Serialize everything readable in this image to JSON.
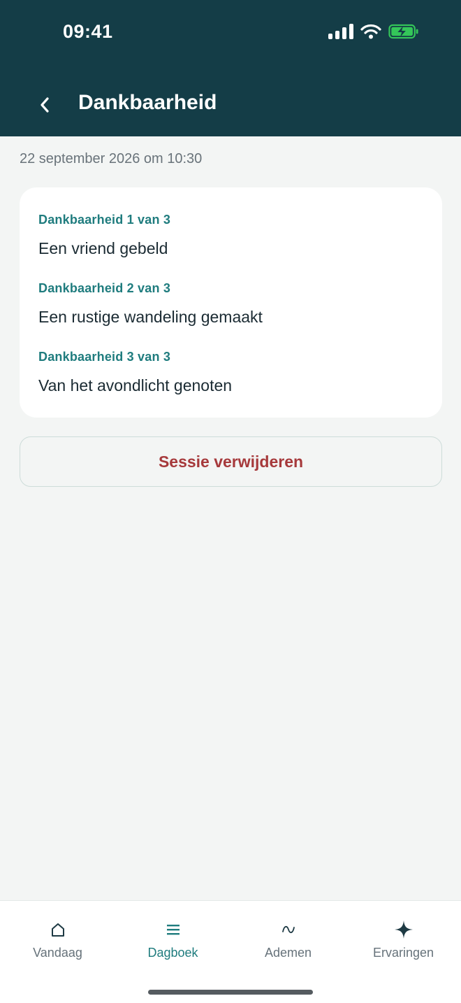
{
  "status_bar": {
    "time": "09:41"
  },
  "header": {
    "title": "Dankbaarheid"
  },
  "timestamp": "22 september 2026 om 10:30",
  "entries": [
    {
      "label": "Dankbaarheid 1 van 3",
      "text": "Een vriend gebeld"
    },
    {
      "label": "Dankbaarheid 2 van 3",
      "text": "Een rustige wandeling gemaakt"
    },
    {
      "label": "Dankbaarheid 3 van 3",
      "text": "Van het avondlicht genoten"
    }
  ],
  "delete_button": {
    "label": "Sessie verwijderen"
  },
  "tabs": [
    {
      "label": "Vandaag",
      "icon": "home-icon"
    },
    {
      "label": "Dagboek",
      "icon": "list-icon",
      "active": true
    },
    {
      "label": "Ademen",
      "icon": "wave-icon"
    },
    {
      "label": "Ervaringen",
      "icon": "sparkle-icon"
    }
  ],
  "colors": {
    "header_bg": "#143d47",
    "accent": "#1f7c7e",
    "danger": "#a6393b",
    "battery": "#34c759"
  }
}
